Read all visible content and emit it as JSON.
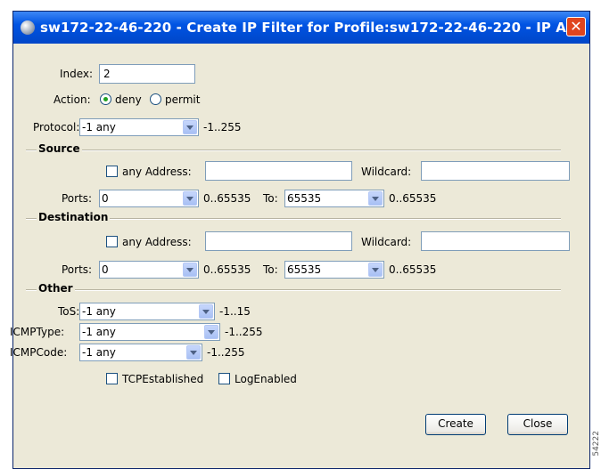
{
  "window": {
    "title": "sw172-22-46-220 - Create IP Filter for Profile:sw172-22-46-220 - IP A..."
  },
  "index": {
    "label": "Index:",
    "value": "2"
  },
  "action": {
    "label": "Action:",
    "options": [
      {
        "label": "deny",
        "checked": true
      },
      {
        "label": "permit",
        "checked": false
      }
    ]
  },
  "protocol": {
    "label": "Protocol:",
    "value": "-1 any",
    "range": "-1..255"
  },
  "source": {
    "group_title": "Source",
    "any_address_label": "any Address:",
    "address_value": "",
    "wildcard_label": "Wildcard:",
    "wildcard_value": "",
    "ports_label": "Ports:",
    "port_from": "0",
    "port_from_range": "0..65535",
    "to_label": "To:",
    "port_to": "65535",
    "port_to_range": "0..65535"
  },
  "destination": {
    "group_title": "Destination",
    "any_address_label": "any Address:",
    "address_value": "",
    "wildcard_label": "Wildcard:",
    "wildcard_value": "",
    "ports_label": "Ports:",
    "port_from": "0",
    "port_from_range": "0..65535",
    "to_label": "To:",
    "port_to": "65535",
    "port_to_range": "0..65535"
  },
  "other": {
    "group_title": "Other",
    "tos": {
      "label": "ToS:",
      "value": "-1 any",
      "range": "-1..15"
    },
    "icmp_type": {
      "label": "ICMPType:",
      "value": "-1 any",
      "range": "-1..255"
    },
    "icmp_code": {
      "label": "ICMPCode:",
      "value": "-1 any",
      "range": "-1..255"
    },
    "tcp_established_label": "TCPEstablished",
    "log_enabled_label": "LogEnabled"
  },
  "buttons": {
    "create": "Create",
    "close": "Close"
  },
  "side_text": "54222"
}
